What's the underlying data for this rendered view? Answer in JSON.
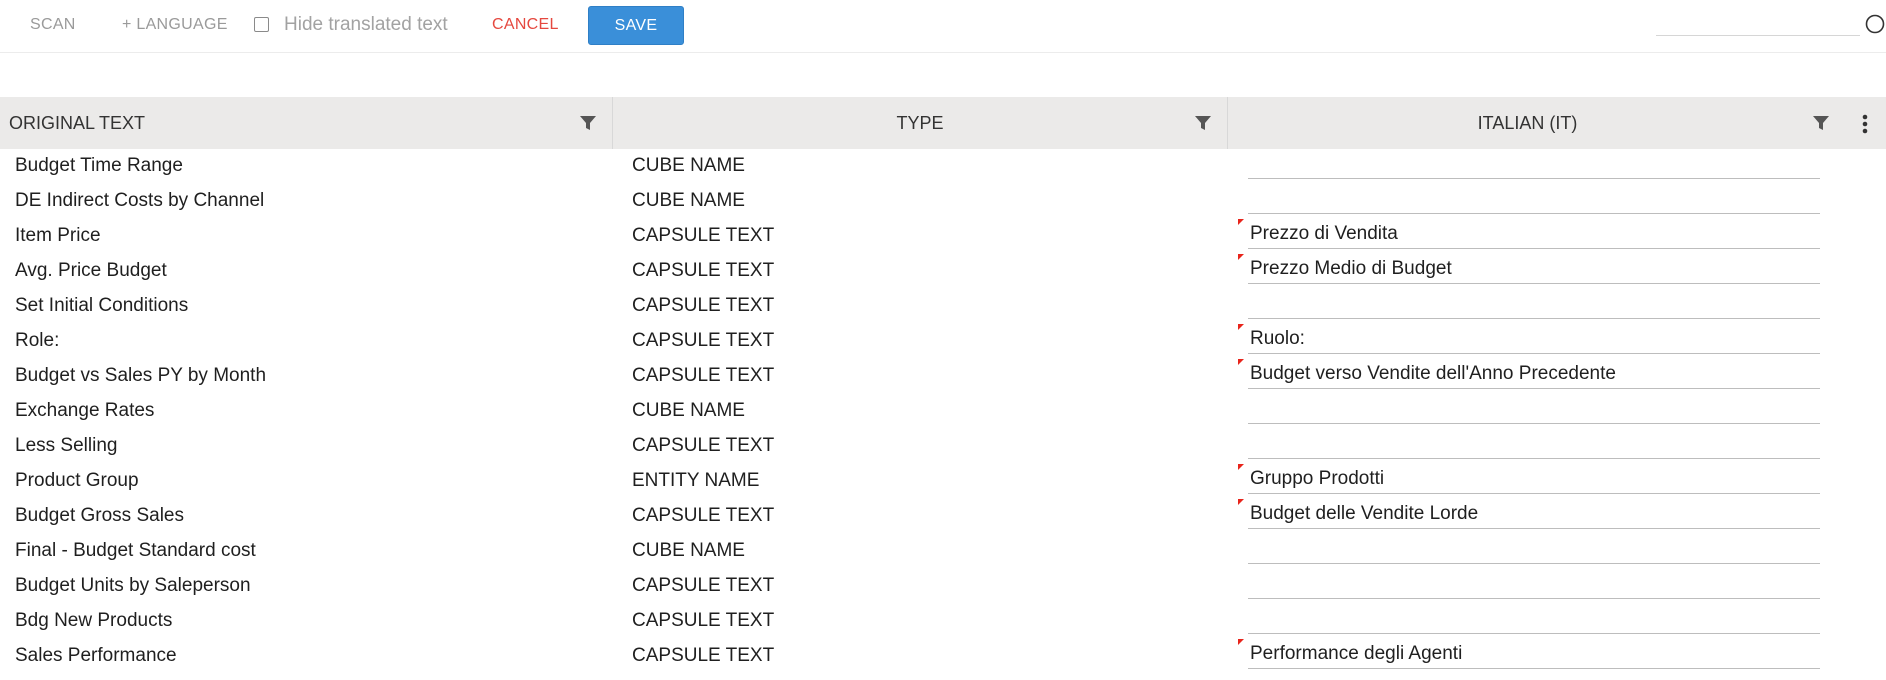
{
  "toolbar": {
    "scan_label": "SCAN",
    "language_label": "+ LANGUAGE",
    "hide_translated_label": "Hide translated text",
    "hide_translated_checked": false,
    "cancel_label": "CANCEL",
    "save_label": "SAVE",
    "search_value": ""
  },
  "table": {
    "columns": [
      "ORIGINAL TEXT",
      "TYPE",
      "ITALIAN (IT)"
    ],
    "rows": [
      {
        "original": "Budget Time Range",
        "type": "CUBE NAME",
        "italian": "",
        "flagged": false
      },
      {
        "original": "DE Indirect Costs by Channel",
        "type": "CUBE NAME",
        "italian": "",
        "flagged": false
      },
      {
        "original": "Item Price",
        "type": "CAPSULE TEXT",
        "italian": "Prezzo di Vendita",
        "flagged": true
      },
      {
        "original": "Avg. Price Budget",
        "type": "CAPSULE TEXT",
        "italian": "Prezzo Medio di Budget",
        "flagged": true
      },
      {
        "original": "Set Initial Conditions",
        "type": "CAPSULE TEXT",
        "italian": "",
        "flagged": false
      },
      {
        "original": "Role:",
        "type": "CAPSULE TEXT",
        "italian": "Ruolo:",
        "flagged": true
      },
      {
        "original": "Budget vs Sales PY by Month",
        "type": "CAPSULE TEXT",
        "italian": "Budget verso Vendite dell'Anno Precedente",
        "flagged": true
      },
      {
        "original": "Exchange Rates",
        "type": "CUBE NAME",
        "italian": "",
        "flagged": false
      },
      {
        "original": "Less Selling",
        "type": "CAPSULE TEXT",
        "italian": "",
        "flagged": false
      },
      {
        "original": "Product Group",
        "type": "ENTITY NAME",
        "italian": "Gruppo Prodotti",
        "flagged": true
      },
      {
        "original": "Budget Gross Sales",
        "type": "CAPSULE TEXT",
        "italian": "Budget delle Vendite Lorde",
        "flagged": true
      },
      {
        "original": "Final - Budget Standard cost",
        "type": "CUBE NAME",
        "italian": "",
        "flagged": false
      },
      {
        "original": "Budget Units by Saleperson",
        "type": "CAPSULE TEXT",
        "italian": "",
        "flagged": false
      },
      {
        "original": "Bdg New Products",
        "type": "CAPSULE TEXT",
        "italian": "",
        "flagged": false
      },
      {
        "original": "Sales Performance",
        "type": "CAPSULE TEXT",
        "italian": "Performance degli Agenti",
        "flagged": true
      }
    ]
  },
  "colors": {
    "accent": "#3a8fd9",
    "cancel": "#e5483f",
    "flag": "#e8241b",
    "header_bg": "#ebeae9"
  }
}
